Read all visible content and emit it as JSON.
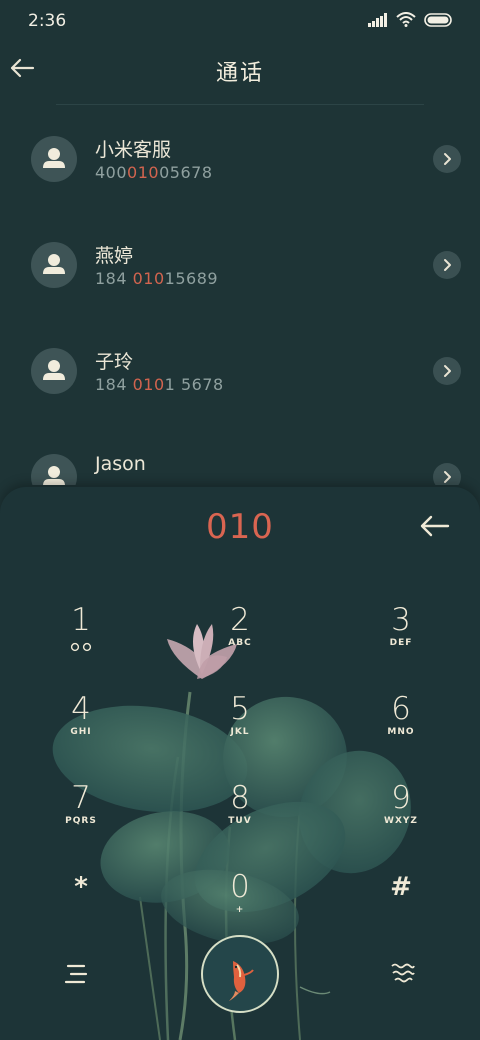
{
  "status_bar": {
    "time": "2:36"
  },
  "header": {
    "title": "通话"
  },
  "contacts": [
    {
      "name": "小米客服",
      "number_pre": "400",
      "number_match": "010",
      "number_post": "05678"
    },
    {
      "name": "燕婷",
      "number_pre": "184 ",
      "number_match": "010",
      "number_post": "15689"
    },
    {
      "name": "子玲",
      "number_pre": "184 ",
      "number_match": "010",
      "number_post": "1 5678"
    },
    {
      "name": "Jason",
      "number_pre": "",
      "number_match": "",
      "number_post": ""
    }
  ],
  "dialpad": {
    "entered": "010",
    "keys": [
      {
        "digit": "1",
        "letters": ""
      },
      {
        "digit": "2",
        "letters": "ABC"
      },
      {
        "digit": "3",
        "letters": "DEF"
      },
      {
        "digit": "4",
        "letters": "GHI"
      },
      {
        "digit": "5",
        "letters": "JKL"
      },
      {
        "digit": "6",
        "letters": "MNO"
      },
      {
        "digit": "7",
        "letters": "PQRS"
      },
      {
        "digit": "8",
        "letters": "TUV"
      },
      {
        "digit": "9",
        "letters": "WXYZ"
      },
      {
        "digit": "*",
        "letters": ""
      },
      {
        "digit": "0",
        "letters": "+"
      },
      {
        "digit": "#",
        "letters": ""
      }
    ]
  },
  "colors": {
    "background": "#1e3436",
    "match_highlight": "#d2644f",
    "dial_text": "#d96551",
    "key_text": "#efe9d6"
  },
  "icons": {
    "back": "arrow-left-icon",
    "chevron": "chevron-right-icon",
    "avatar": "person-icon",
    "backspace": "backspace-arrow-icon",
    "menu": "menu-lines-icon",
    "call": "koi-fish-icon",
    "wave": "wave-pattern-icon",
    "voicemail": "voicemail-icon"
  }
}
